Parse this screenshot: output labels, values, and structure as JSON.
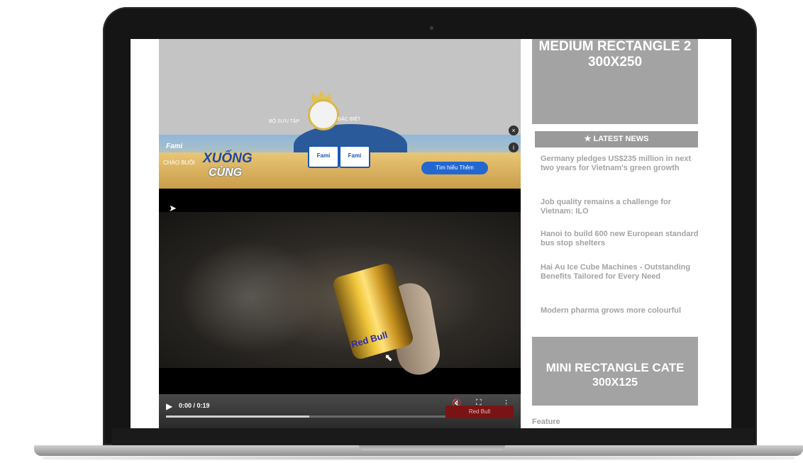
{
  "banner_ad": {
    "brand": "Fami",
    "prefix": "CHÀO BUỔI",
    "headline1": "XUỐNG",
    "headline2": "CÙNG",
    "mini_text_1": "BỘ SƯU TẬP",
    "mini_text_2": "ĐẶC BIỆT",
    "product_label": "Fami",
    "cta_label": "Tìm hiểu Thêm",
    "close_glyph": "×",
    "info_glyph": "i"
  },
  "video": {
    "time": "0:00 / 0:19",
    "progress_fraction": 0.42,
    "can_text": "Red Bull",
    "share_glyph": "➤",
    "play_glyph": "▶",
    "mute_glyph": "🔇",
    "fullscreen_glyph": "⛶",
    "more_glyph": "⋮",
    "cursor_glyph": "⬉",
    "brand_box_text": "Red Bull"
  },
  "sidebar": {
    "medium_rect_line1": "MEDIUM RECTANGLE 2",
    "medium_rect_line2": "300X250",
    "news_header": "★  LATEST NEWS",
    "news": [
      "Germany pledges US$235 million in next two years for Vietnam's green growth",
      "Job quality remains a challenge for Vietnam: ILO",
      "Hanoi to build 600 new European standard bus stop shelters",
      "Hai Au Ice Cube Machines - Outstanding Benefits Tailored for Every Need",
      "Modern pharma grows more colourful"
    ],
    "mini_rect_line1": "MINI RECTANGLE CATE",
    "mini_rect_line2": "300X125",
    "feature_label": "Feature"
  }
}
